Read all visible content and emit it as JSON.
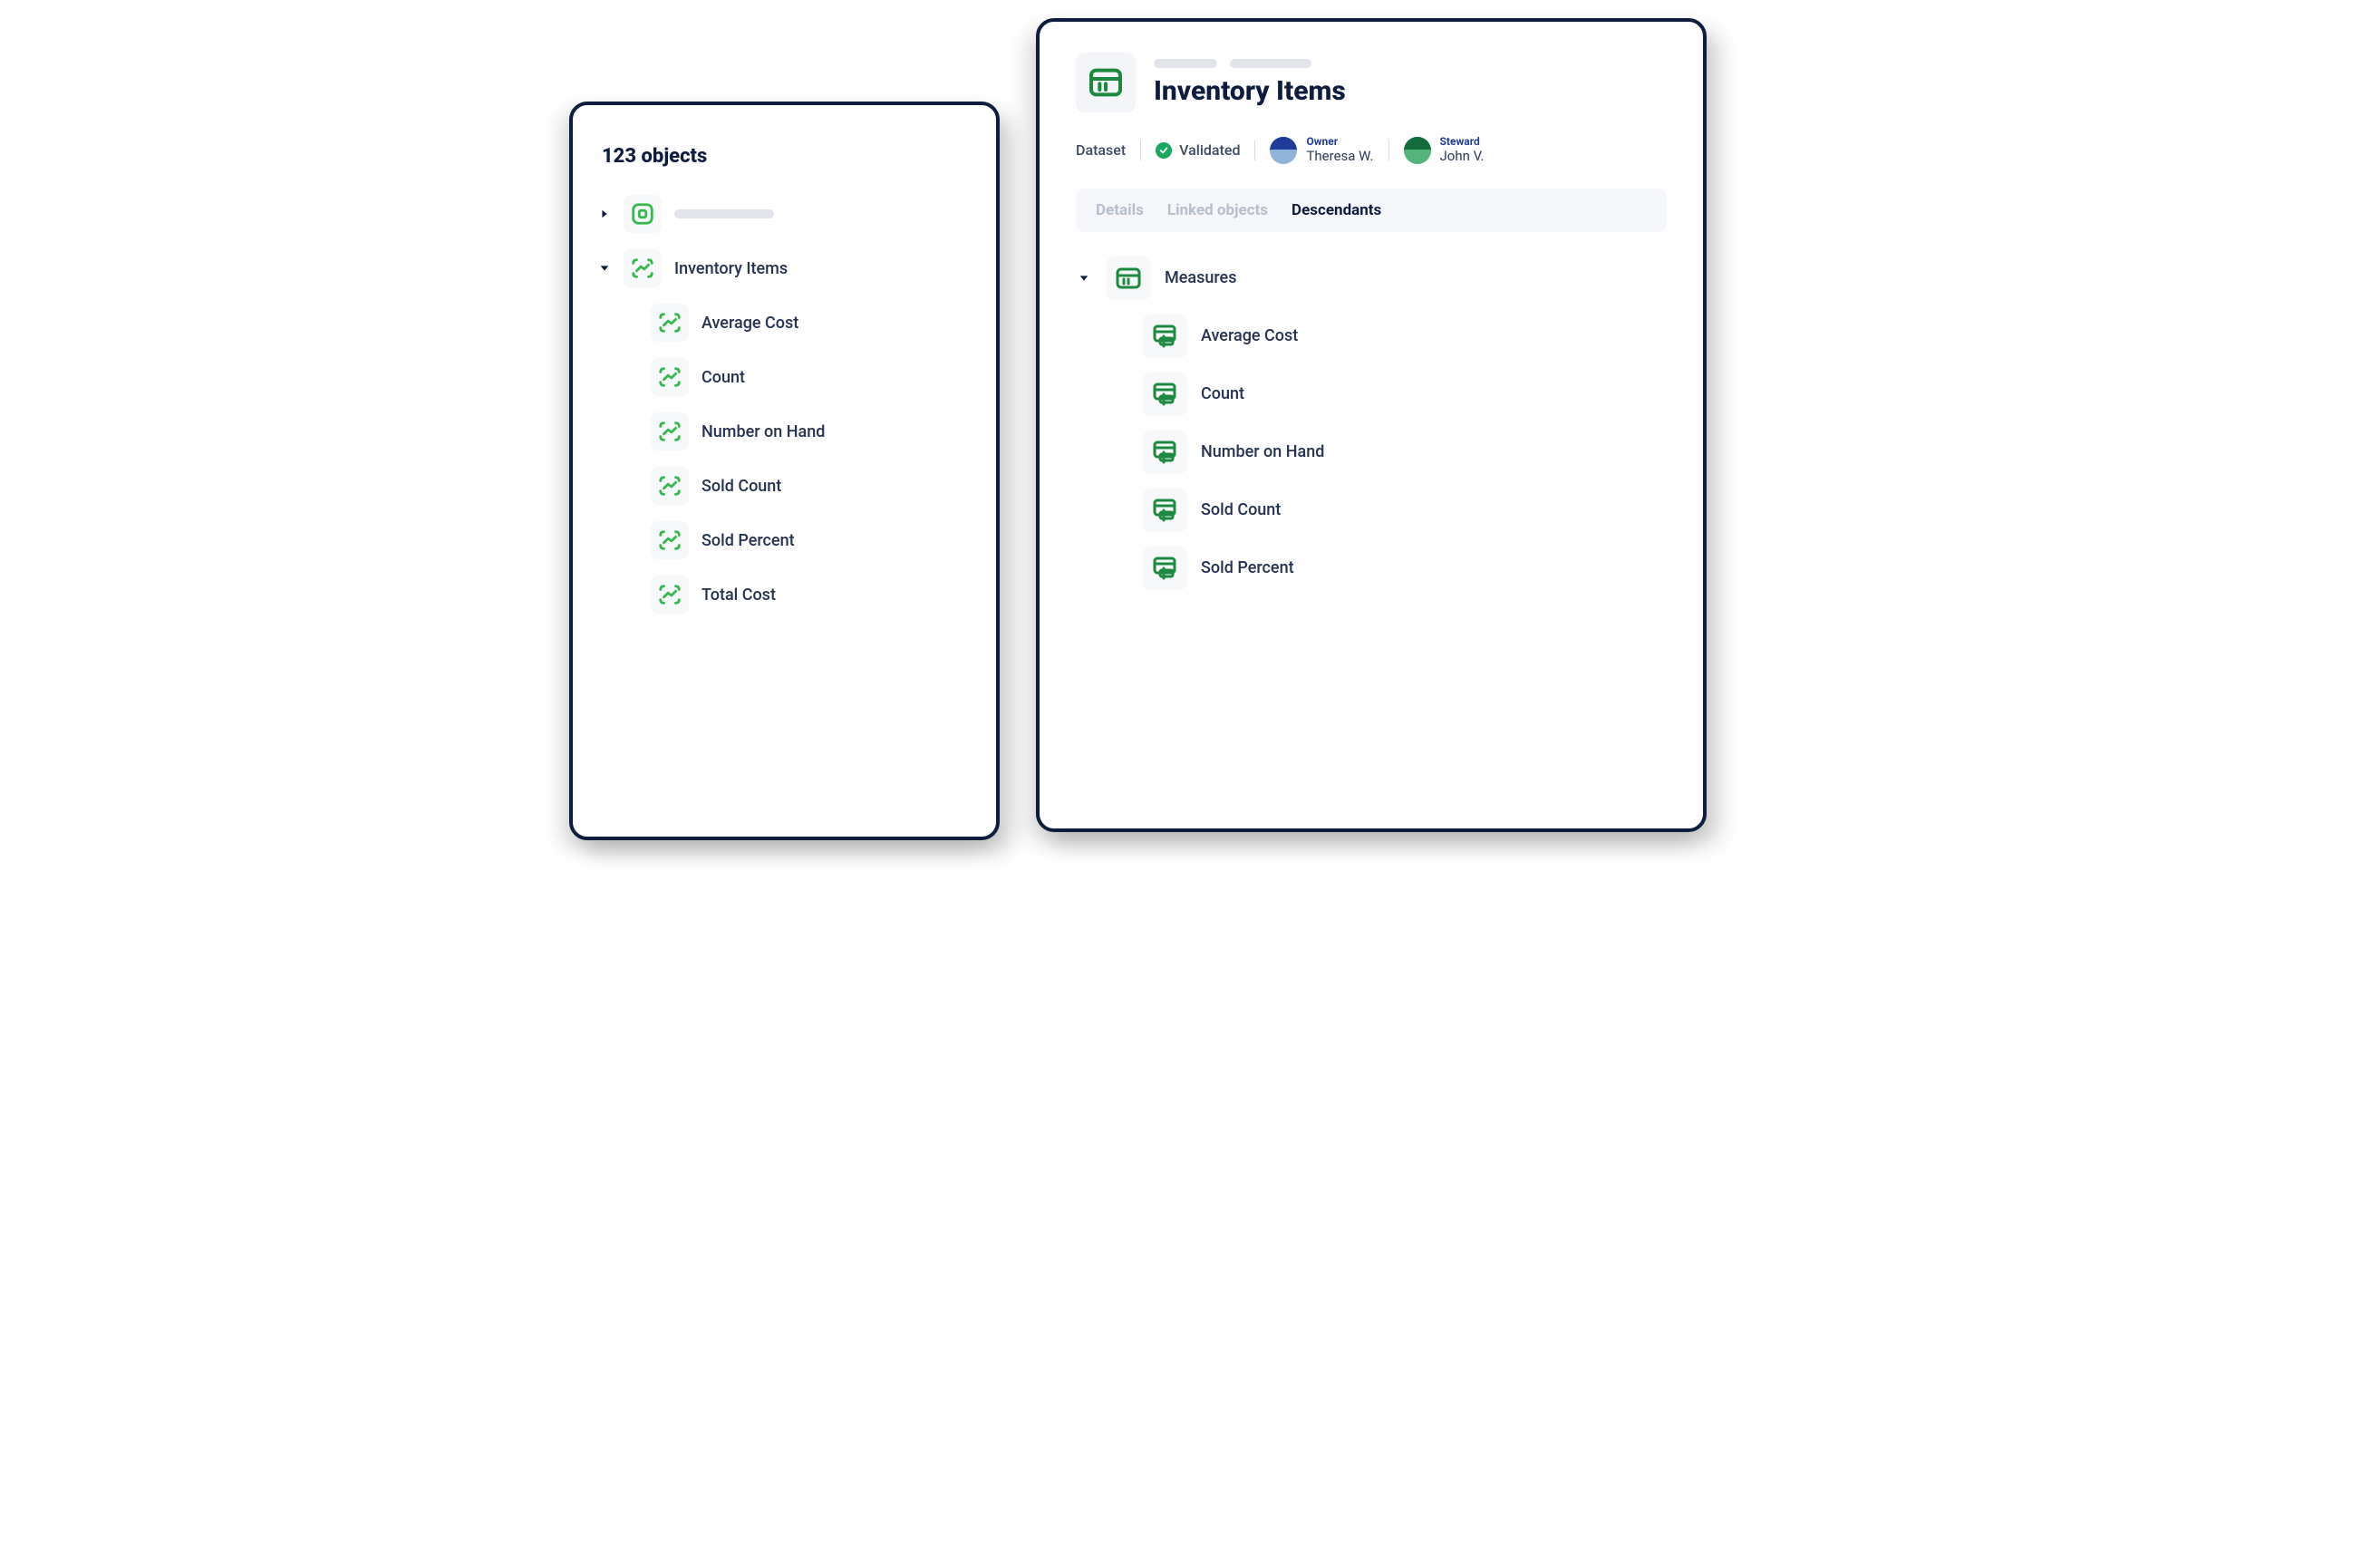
{
  "left_panel": {
    "count_text": "123 objects",
    "tree": [
      {
        "expanded": false,
        "label": null,
        "icon": "dashboard-json-icon"
      },
      {
        "expanded": true,
        "label": "Inventory Items",
        "icon": "chart-metric-icon",
        "children": [
          {
            "label": "Average Cost",
            "icon": "chart-metric-icon"
          },
          {
            "label": "Count",
            "icon": "chart-metric-icon"
          },
          {
            "label": "Number on Hand",
            "icon": "chart-metric-icon"
          },
          {
            "label": "Sold Count",
            "icon": "chart-metric-icon"
          },
          {
            "label": "Sold Percent",
            "icon": "chart-metric-icon"
          },
          {
            "label": "Total Cost",
            "icon": "chart-metric-icon"
          }
        ]
      }
    ]
  },
  "right_panel": {
    "title": "Inventory Items",
    "type": "Dataset",
    "status": "Validated",
    "owner": {
      "role": "Owner",
      "name": "Theresa W."
    },
    "steward": {
      "role": "Steward",
      "name": "John V."
    },
    "tabs": [
      {
        "label": "Details",
        "active": false
      },
      {
        "label": "Linked objects",
        "active": false
      },
      {
        "label": "Descendants",
        "active": true
      }
    ],
    "tree": {
      "parent": {
        "label": "Measures",
        "icon": "table-icon"
      },
      "children": [
        {
          "label": "Average Cost",
          "icon": "column-icon"
        },
        {
          "label": "Count",
          "icon": "column-icon"
        },
        {
          "label": "Number on Hand",
          "icon": "column-icon"
        },
        {
          "label": "Sold Count",
          "icon": "column-icon"
        },
        {
          "label": "Sold Percent",
          "icon": "column-icon"
        }
      ]
    }
  }
}
